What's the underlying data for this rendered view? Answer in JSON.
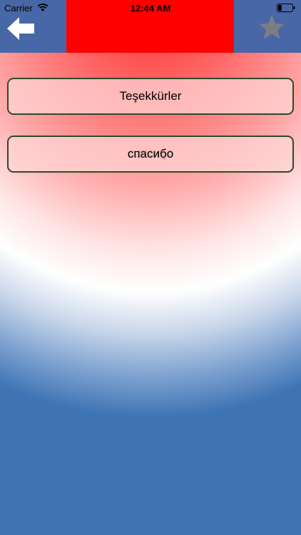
{
  "status_bar": {
    "carrier": "Carrier",
    "time": "12:44 AM"
  },
  "nav": {
    "back_icon": "back-arrow-icon",
    "favorite_icon": "star-icon",
    "colors": {
      "center": "#ff0000",
      "sides": "#4867a6"
    }
  },
  "words": [
    {
      "label": "Teşekkürler"
    },
    {
      "label": "спасибо"
    }
  ]
}
